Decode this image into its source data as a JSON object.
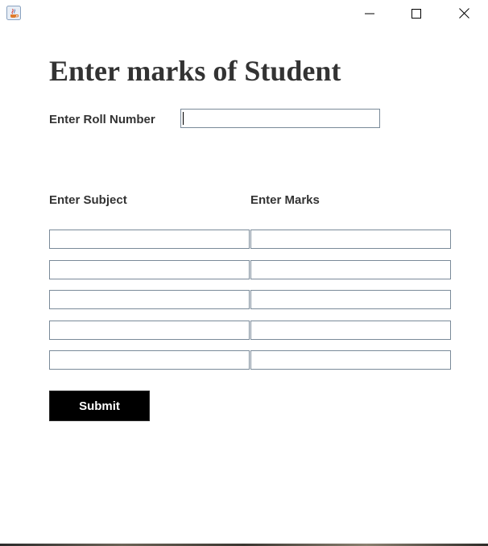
{
  "window": {
    "icon": "java-coffee-icon",
    "controls": [
      "minimize-icon",
      "maximize-icon",
      "close-icon"
    ]
  },
  "form": {
    "heading": "Enter marks of Student",
    "roll_label": "Enter Roll Number",
    "roll_value": "",
    "subject_header": "Enter Subject",
    "marks_header": "Enter Marks",
    "rows": [
      {
        "subject": "",
        "marks": ""
      },
      {
        "subject": "",
        "marks": ""
      },
      {
        "subject": "",
        "marks": ""
      },
      {
        "subject": "",
        "marks": ""
      },
      {
        "subject": "",
        "marks": ""
      }
    ],
    "submit_label": "Submit"
  },
  "colors": {
    "field_border": "#7a8a99",
    "button_bg": "#000000",
    "button_text": "#ffffff",
    "text": "#333333"
  }
}
